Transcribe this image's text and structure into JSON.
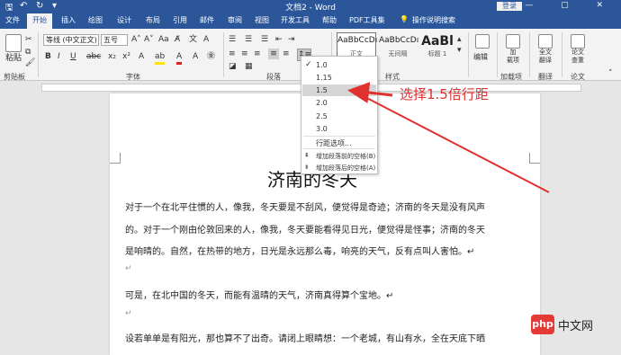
{
  "titlebar": {
    "title": "文档2 - Word",
    "login": "登录",
    "window_controls": "— ▢ ✕",
    "save_icon": "save-icon",
    "undo_icon": "undo-icon",
    "redo_icon": "redo-icon",
    "brand_color": "#2b579a"
  },
  "tabs": [
    "文件",
    "开始",
    "插入",
    "绘图",
    "设计",
    "布局",
    "引用",
    "邮件",
    "审阅",
    "视图",
    "开发工具",
    "帮助",
    "PDF工具集",
    "操作说明搜索"
  ],
  "ribbon": {
    "paste_label": "粘贴",
    "clipboard_label": "剪贴板",
    "font_name": "等线 (中文正文)",
    "font_size": "五号",
    "font_group_label": "字体",
    "paragraph_group_label": "段落",
    "styles_group_label": "样式",
    "styles": [
      {
        "sample": "AaBbCcDı",
        "name": "正文"
      },
      {
        "sample": "AaBbCcDı",
        "name": "无间隔"
      },
      {
        "sample": "AaBl",
        "name": "标题 1"
      }
    ],
    "edit_label": "编辑",
    "addins": [
      {
        "label": "加\n载项"
      },
      {
        "label": "全文\n翻译"
      },
      {
        "label": "论文\n查重"
      }
    ],
    "addins_group_label": "加载项",
    "translate_group_label": "翻译",
    "paper_group_label": "论文"
  },
  "line_spacing_menu": {
    "options": [
      "1.0",
      "1.15",
      "1.5",
      "2.0",
      "2.5",
      "3.0"
    ],
    "checked": "1.0",
    "selected": "1.5",
    "more": "行距选项...",
    "add_before": "增加段落前的空格(B)",
    "add_after": "增加段落后的空格(A)"
  },
  "annotation": {
    "text": "选择1.5倍行距",
    "color": "#e03030"
  },
  "document": {
    "title": "济南的冬天",
    "lines": [
      "对于一个在北平住惯的人，像我，冬天要是不刮风，便觉得是奇迹；济南的冬天是没有风声",
      "的。对于一个刚由伦敦回来的人，像我，冬天要能看得见日光，便觉得是怪事；济南的冬天",
      "是响晴的。自然，在热带的地方，日光是永远那么毒，响亮的天气，反有点叫人害怕。↵",
      "可是，在北中国的冬天，而能有温晴的天气，济南真得算个宝地。↵",
      "设若单单是有阳光，那也算不了出奇。请闭上眼睛想：一个老城，有山有水，全在天底下晒"
    ],
    "para_mark": "↵"
  },
  "watermark": {
    "badge": "php",
    "text": "中文网"
  }
}
